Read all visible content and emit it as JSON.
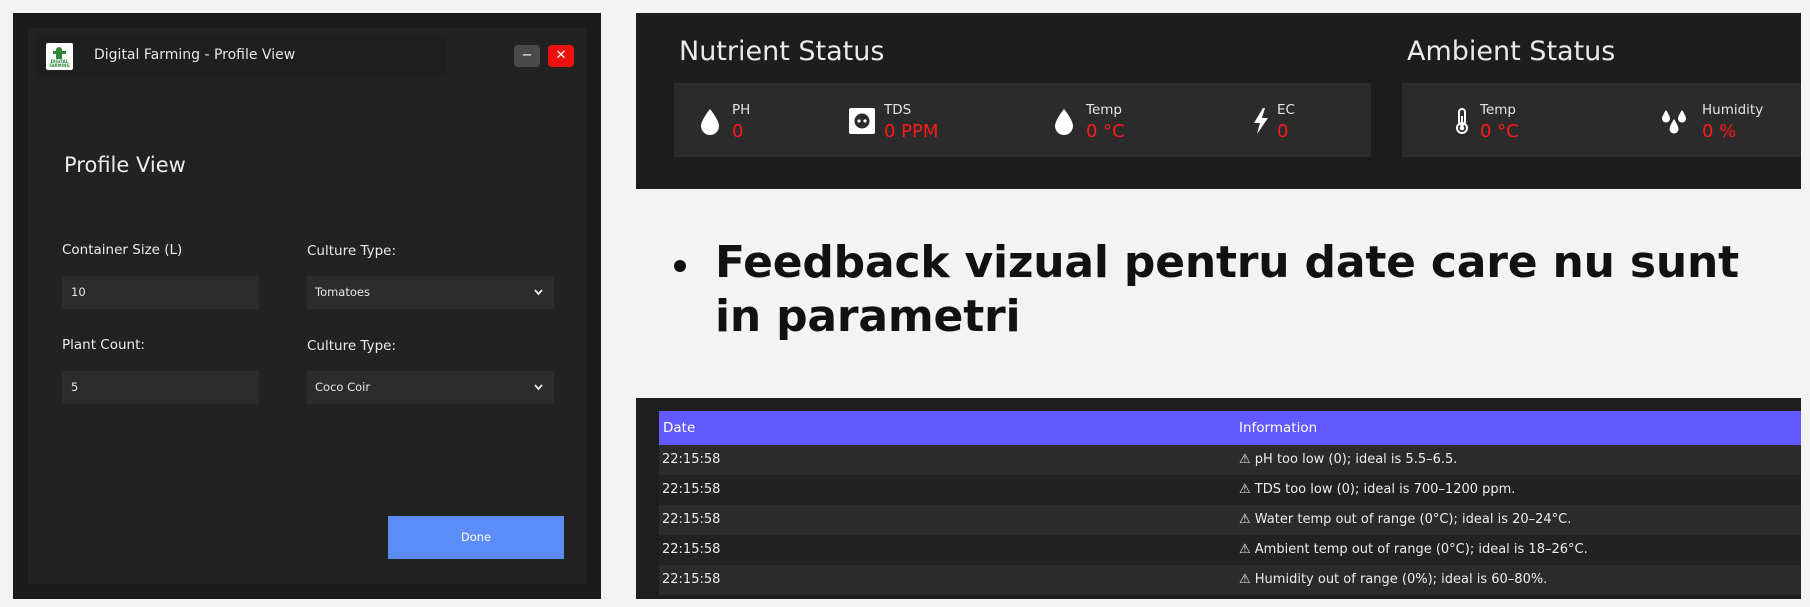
{
  "profile_window": {
    "title": "Digital Farming - Profile View",
    "logo_text": "DIGITAL FARMING",
    "minimize_label": "−",
    "close_label": "✕",
    "section_title": "Profile View",
    "container_size_label": "Container Size (L)",
    "container_size_value": "10",
    "culture_type_label_1": "Culture Type:",
    "culture_type_value_1": "Tomatoes",
    "plant_count_label": "Plant Count:",
    "plant_count_value": "5",
    "culture_type_label_2": "Culture Type:",
    "culture_type_value_2": "Coco Coir",
    "done_label": "Done"
  },
  "nutrient_status": {
    "title": "Nutrient Status",
    "metrics": [
      {
        "name": "PH",
        "value": "0",
        "icon": "droplet-icon"
      },
      {
        "name": "TDS",
        "value": "0 PPM",
        "icon": "socket-icon"
      },
      {
        "name": "Temp",
        "value": "0 °C",
        "icon": "droplet-icon"
      },
      {
        "name": "EC",
        "value": "0",
        "icon": "lightning-icon"
      }
    ]
  },
  "ambient_status": {
    "title": "Ambient Status",
    "metrics": [
      {
        "name": "Temp",
        "value": "0 °C",
        "icon": "thermometer-icon"
      },
      {
        "name": "Humidity",
        "value": "0 %",
        "icon": "droplets-icon"
      }
    ]
  },
  "bullet": {
    "text": "Feedback vizual pentru date care nu sunt in parametri"
  },
  "log_table": {
    "headers": [
      "Date",
      "Information"
    ],
    "rows": [
      [
        "22:15:58",
        "⚠ pH too low (0); ideal is 5.5–6.5."
      ],
      [
        "22:15:58",
        "⚠ TDS too low (0); ideal is 700–1200 ppm."
      ],
      [
        "22:15:58",
        "⚠ Water temp out of range (0°C); ideal is 20–24°C."
      ],
      [
        "22:15:58",
        "⚠ Ambient temp out of range (0°C); ideal is 18–26°C."
      ],
      [
        "22:15:58",
        "⚠ Humidity out of range (0%); ideal is 60–80%."
      ]
    ]
  },
  "colors": {
    "alert_value": "#ff1a1a",
    "header_accent": "#6159ff",
    "done_button": "#5c8cf5",
    "close_button": "#ee0f0f"
  }
}
